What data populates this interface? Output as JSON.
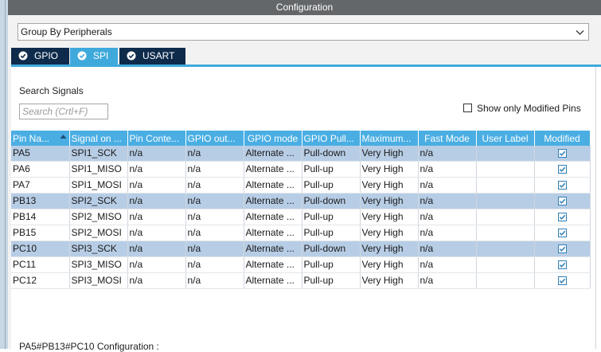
{
  "window": {
    "title": "Configuration"
  },
  "group_by": {
    "value": "Group By Peripherals"
  },
  "tabs": [
    {
      "label": "GPIO",
      "color": "#0e2b4c"
    },
    {
      "label": "SPI",
      "color": "#3fa9dc"
    },
    {
      "label": "USART",
      "color": "#0e2b4c"
    }
  ],
  "search": {
    "label": "Search Signals",
    "placeholder": "Search (Crtl+F)"
  },
  "only_modified": {
    "label": "Show only Modified Pins"
  },
  "table": {
    "columns": [
      "Pin Na...",
      "Signal on ...",
      "Pin Conte...",
      "GPIO out...",
      "GPIO mode",
      "GPIO Pull...",
      "Maximum...",
      "Fast Mode",
      "User Label",
      "Modified"
    ],
    "rows": [
      {
        "pin": "PA5",
        "signal": "SPI1_SCK",
        "context": "n/a",
        "output": "n/a",
        "mode": "Alternate ...",
        "pull": "Pull-down",
        "max": "Very High",
        "fast": "n/a",
        "label": "",
        "modified": true,
        "highlight": true
      },
      {
        "pin": "PA6",
        "signal": "SPI1_MISO",
        "context": "n/a",
        "output": "n/a",
        "mode": "Alternate ...",
        "pull": "Pull-up",
        "max": "Very High",
        "fast": "n/a",
        "label": "",
        "modified": true,
        "highlight": false
      },
      {
        "pin": "PA7",
        "signal": "SPI1_MOSI",
        "context": "n/a",
        "output": "n/a",
        "mode": "Alternate ...",
        "pull": "Pull-up",
        "max": "Very High",
        "fast": "n/a",
        "label": "",
        "modified": true,
        "highlight": false
      },
      {
        "pin": "PB13",
        "signal": "SPI2_SCK",
        "context": "n/a",
        "output": "n/a",
        "mode": "Alternate ...",
        "pull": "Pull-down",
        "max": "Very High",
        "fast": "n/a",
        "label": "",
        "modified": true,
        "highlight": true
      },
      {
        "pin": "PB14",
        "signal": "SPI2_MISO",
        "context": "n/a",
        "output": "n/a",
        "mode": "Alternate ...",
        "pull": "Pull-up",
        "max": "Very High",
        "fast": "n/a",
        "label": "",
        "modified": true,
        "highlight": false
      },
      {
        "pin": "PB15",
        "signal": "SPI2_MOSI",
        "context": "n/a",
        "output": "n/a",
        "mode": "Alternate ...",
        "pull": "Pull-up",
        "max": "Very High",
        "fast": "n/a",
        "label": "",
        "modified": true,
        "highlight": false
      },
      {
        "pin": "PC10",
        "signal": "SPI3_SCK",
        "context": "n/a",
        "output": "n/a",
        "mode": "Alternate ...",
        "pull": "Pull-down",
        "max": "Very High",
        "fast": "n/a",
        "label": "",
        "modified": true,
        "highlight": true
      },
      {
        "pin": "PC11",
        "signal": "SPI3_MISO",
        "context": "n/a",
        "output": "n/a",
        "mode": "Alternate ...",
        "pull": "Pull-up",
        "max": "Very High",
        "fast": "n/a",
        "label": "",
        "modified": true,
        "highlight": false
      },
      {
        "pin": "PC12",
        "signal": "SPI3_MOSI",
        "context": "n/a",
        "output": "n/a",
        "mode": "Alternate ...",
        "pull": "Pull-up",
        "max": "Very High",
        "fast": "n/a",
        "label": "",
        "modified": true,
        "highlight": false
      }
    ]
  },
  "footer": {
    "text": "PA5#PB13#PC10 Configuration :"
  },
  "colors": {
    "header": "#4aaee3",
    "highlight_row": "#b7cde5",
    "check": "#2f7fb8",
    "title_bar": "#64676a"
  },
  "icons": {
    "tab_icon": "check-circle-icon",
    "sort": "sort-up-icon",
    "dropdown": "chevron-down-icon",
    "modified": "checked-checkbox-icon"
  }
}
